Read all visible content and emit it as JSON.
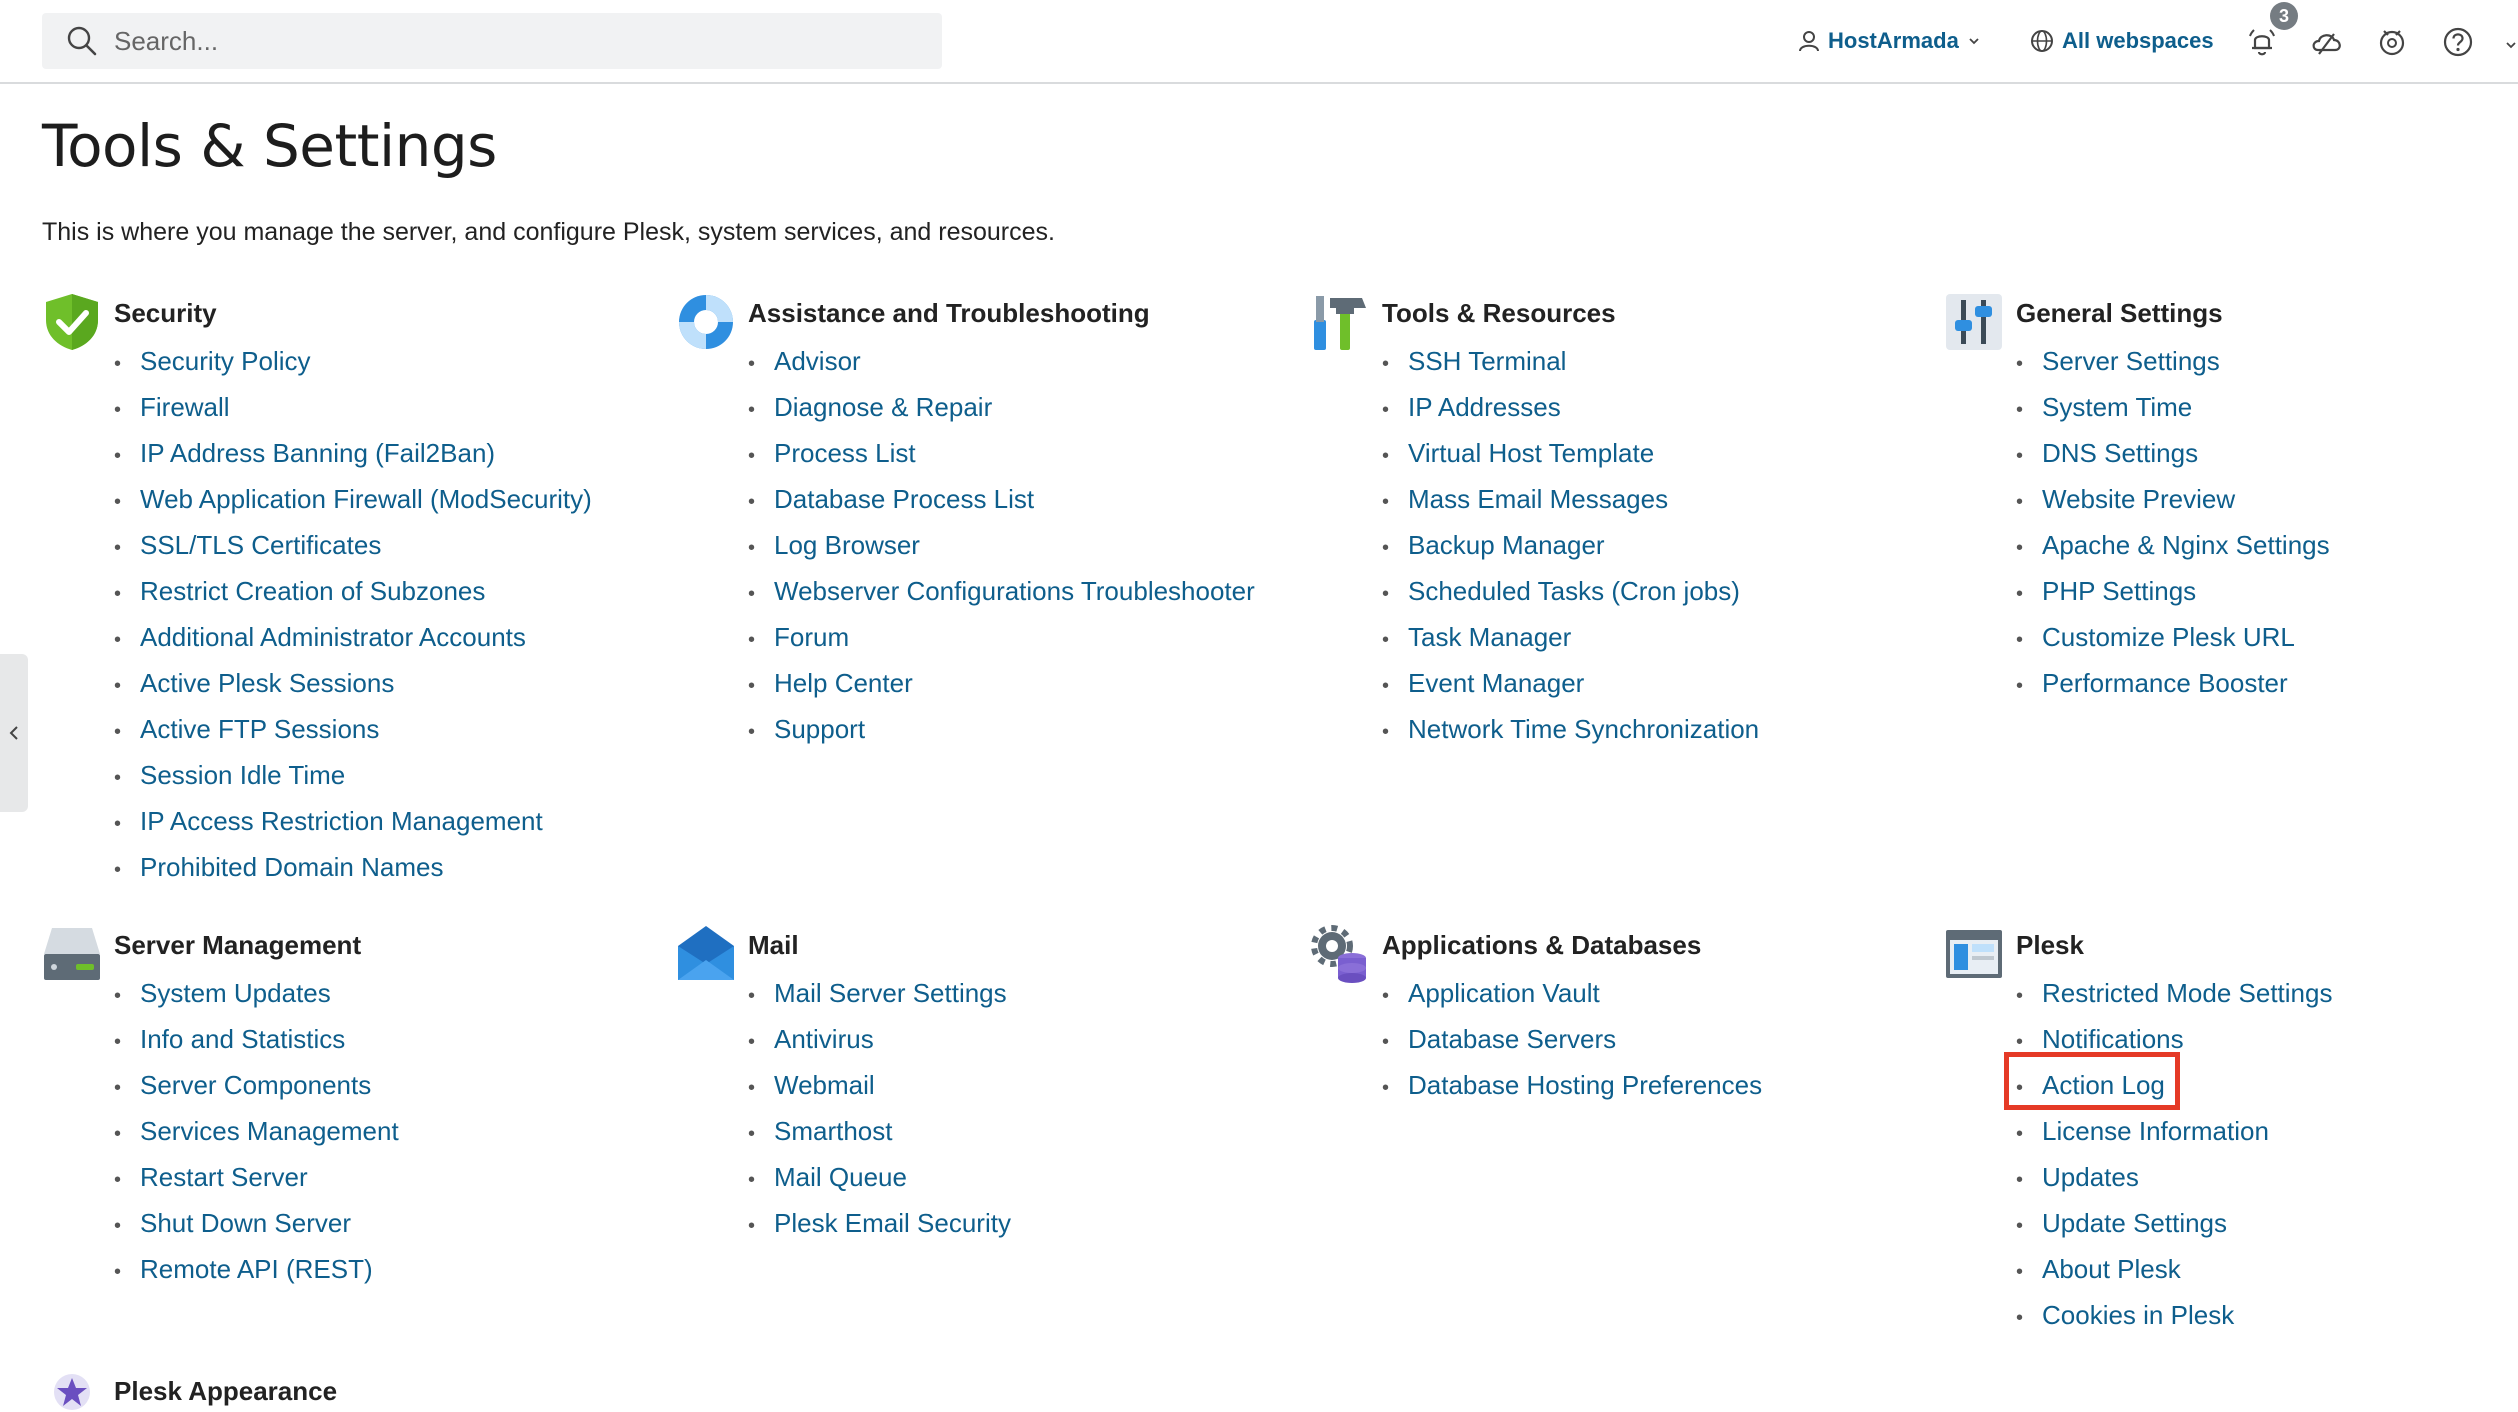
{
  "search": {
    "placeholder": "Search..."
  },
  "header": {
    "user": "HostArmada",
    "webspaces": "All webspaces",
    "notification_count": "3"
  },
  "page": {
    "title": "Tools & Settings",
    "description": "This is where you manage the server, and configure Plesk, system services, and resources."
  },
  "sections": {
    "security": {
      "title": "Security",
      "icon": "shield-icon",
      "items": [
        "Security Policy",
        "Firewall",
        "IP Address Banning (Fail2Ban)",
        "Web Application Firewall (ModSecurity)",
        "SSL/TLS Certificates",
        "Restrict Creation of Subzones",
        "Additional Administrator Accounts",
        "Active Plesk Sessions",
        "Active FTP Sessions",
        "Session Idle Time",
        "IP Access Restriction Management",
        "Prohibited Domain Names"
      ]
    },
    "assistance": {
      "title": "Assistance and Troubleshooting",
      "icon": "lifebuoy-icon",
      "items": [
        "Advisor",
        "Diagnose & Repair",
        "Process List",
        "Database Process List",
        "Log Browser",
        "Webserver Configurations Troubleshooter",
        "Forum",
        "Help Center",
        "Support"
      ]
    },
    "tools": {
      "title": "Tools & Resources",
      "icon": "tools-icon",
      "items": [
        "SSH Terminal",
        "IP Addresses",
        "Virtual Host Template",
        "Mass Email Messages",
        "Backup Manager",
        "Scheduled Tasks (Cron jobs)",
        "Task Manager",
        "Event Manager",
        "Network Time Synchronization"
      ]
    },
    "general": {
      "title": "General Settings",
      "icon": "sliders-icon",
      "items": [
        "Server Settings",
        "System Time",
        "DNS Settings",
        "Website Preview",
        "Apache & Nginx Settings",
        "PHP Settings",
        "Customize Plesk URL",
        "Performance Booster"
      ]
    },
    "server": {
      "title": "Server Management",
      "icon": "server-icon",
      "items": [
        "System Updates",
        "Info and Statistics",
        "Server Components",
        "Services Management",
        "Restart Server",
        "Shut Down Server",
        "Remote API (REST)"
      ]
    },
    "mail": {
      "title": "Mail",
      "icon": "envelope-icon",
      "items": [
        "Mail Server Settings",
        "Antivirus",
        "Webmail",
        "Smarthost",
        "Mail Queue",
        "Plesk Email Security"
      ]
    },
    "apps": {
      "title": "Applications & Databases",
      "icon": "gear-database-icon",
      "items": [
        "Application Vault",
        "Database Servers",
        "Database Hosting Preferences"
      ]
    },
    "plesk": {
      "title": "Plesk",
      "icon": "window-icon",
      "items": [
        "Restricted Mode Settings",
        "Notifications",
        "Action Log",
        "License Information",
        "Updates",
        "Update Settings",
        "About Plesk",
        "Cookies in Plesk"
      ]
    },
    "appearance": {
      "title": "Plesk Appearance",
      "icon": "star-badge-icon",
      "items": []
    }
  },
  "colors": {
    "link": "#0e5e8c",
    "highlight": "#e53a26",
    "text": "#222222"
  }
}
